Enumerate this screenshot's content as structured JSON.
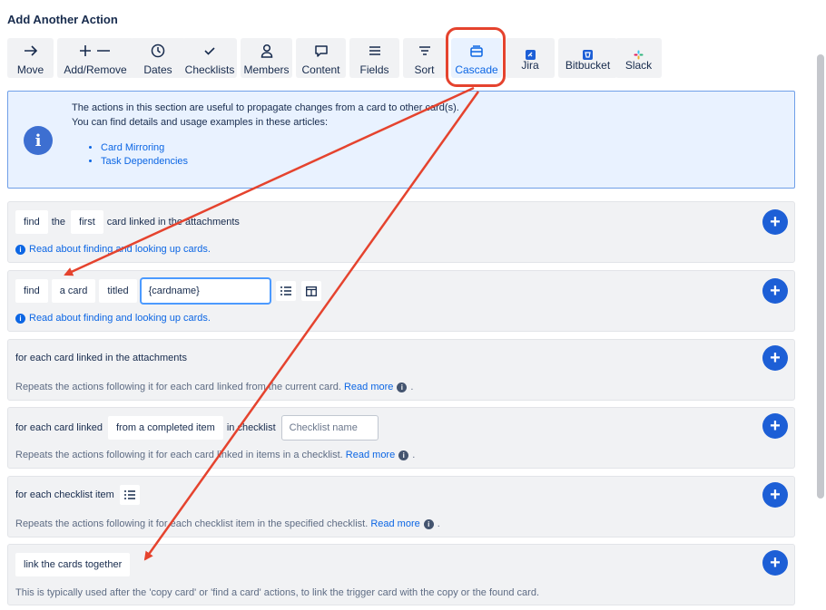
{
  "title": "Add Another Action",
  "tabs": [
    {
      "label": "Move",
      "icon": "arrow-right-icon"
    },
    {
      "label": "Add/Remove",
      "icon": "plus-minus-icon"
    },
    {
      "label": "Dates",
      "icon": "clock-icon"
    },
    {
      "label": "Checklists",
      "icon": "check-icon"
    },
    {
      "label": "Members",
      "icon": "person-icon"
    },
    {
      "label": "Content",
      "icon": "speech-bubble-icon"
    },
    {
      "label": "Fields",
      "icon": "lines-icon"
    },
    {
      "label": "Sort",
      "icon": "sort-icon"
    },
    {
      "label": "Cascade",
      "icon": "cascade-icon"
    },
    {
      "label": "Jira",
      "icon": "jira-icon"
    },
    {
      "label": "Bitbucket",
      "icon": "bitbucket-icon"
    },
    {
      "label": "Slack",
      "icon": "slack-icon"
    }
  ],
  "info": {
    "line1": "The actions in this section are useful to propagate changes from a card to other card(s).",
    "line2": "You can find details and usage examples in these articles:",
    "links": [
      "Card Mirroring",
      "Task Dependencies"
    ]
  },
  "actions": {
    "a1": {
      "w1": "find",
      "w2": "the",
      "w3": "first",
      "w4": "card linked in the attachments",
      "help": "Read about finding and looking up cards."
    },
    "a2": {
      "w1": "find",
      "w2": "a card",
      "w3": "titled",
      "input_value": "{cardname}",
      "help": "Read about finding and looking up cards."
    },
    "a3": {
      "text": "for each card linked in the attachments",
      "help": "Repeats the actions following it for each card linked from the current card.",
      "read_more": "Read more",
      "tail": "."
    },
    "a4": {
      "w1": "for each card linked",
      "w2": "from a completed item",
      "w3": "in checklist",
      "input_placeholder": "Checklist name",
      "help": "Repeats the actions following it for each card linked in items in a checklist.",
      "read_more": "Read more",
      "tail": "."
    },
    "a5": {
      "text": "for each checklist item",
      "help": "Repeats the actions following it for each checklist item in the specified checklist.",
      "read_more": "Read more",
      "tail": "."
    },
    "a6": {
      "chip": "link the cards together",
      "help": "This is typically used after the 'copy card' or 'find a card' actions, to link the trigger card with the copy or the found card."
    }
  },
  "colors": {
    "accent": "#0c66e4",
    "plus_button": "#1d5fd6",
    "annotation": "#e5432e",
    "info_bg": "#e9f2ff"
  }
}
